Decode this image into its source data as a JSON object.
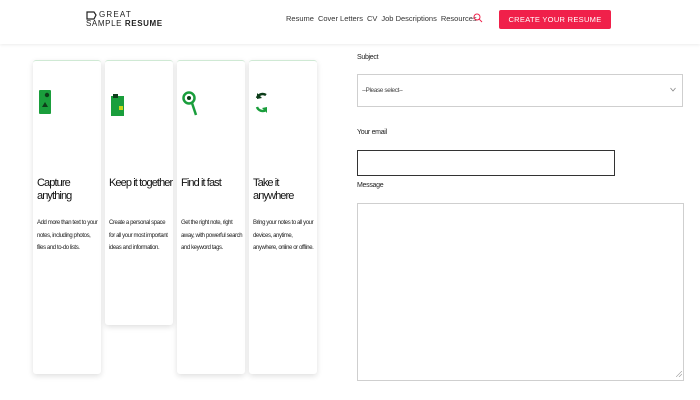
{
  "header": {
    "logo": {
      "line1": "GREAT",
      "line2_plain": "SAMPLE ",
      "line2_bold": "RESUME"
    },
    "nav": [
      {
        "label": "Resume"
      },
      {
        "label": "Cover Letters"
      },
      {
        "label": "CV"
      },
      {
        "label": "Job Descriptions"
      },
      {
        "label": "Resources"
      }
    ],
    "search_icon": "search-icon",
    "cta_label": "CREATE YOUR RESUME"
  },
  "cards": [
    {
      "icon": "elephant-icon",
      "title": "Capture anything",
      "desc": "Add more than text to your notes, including photos, files and to-do lists."
    },
    {
      "icon": "notebook-icon",
      "title": "Keep it together",
      "desc": "Create a personal space for all your most important ideas and information."
    },
    {
      "icon": "search-magnifier-icon",
      "title": "Find it fast",
      "desc": "Get the right note, right away, with powerful search and keyword tags."
    },
    {
      "icon": "sync-icon",
      "title": "Take it anywhere",
      "desc": "Bring your notes to all your devices, anytime, anywhere, online or offline."
    }
  ],
  "form": {
    "subject": {
      "label": "Subject",
      "placeholder": "--Please select--"
    },
    "name": {
      "label": "Your email",
      "value": ""
    },
    "message": {
      "label": "Message",
      "value": ""
    }
  },
  "colors": {
    "accent": "#f0204a",
    "icon_green": "#1a9e3c"
  }
}
